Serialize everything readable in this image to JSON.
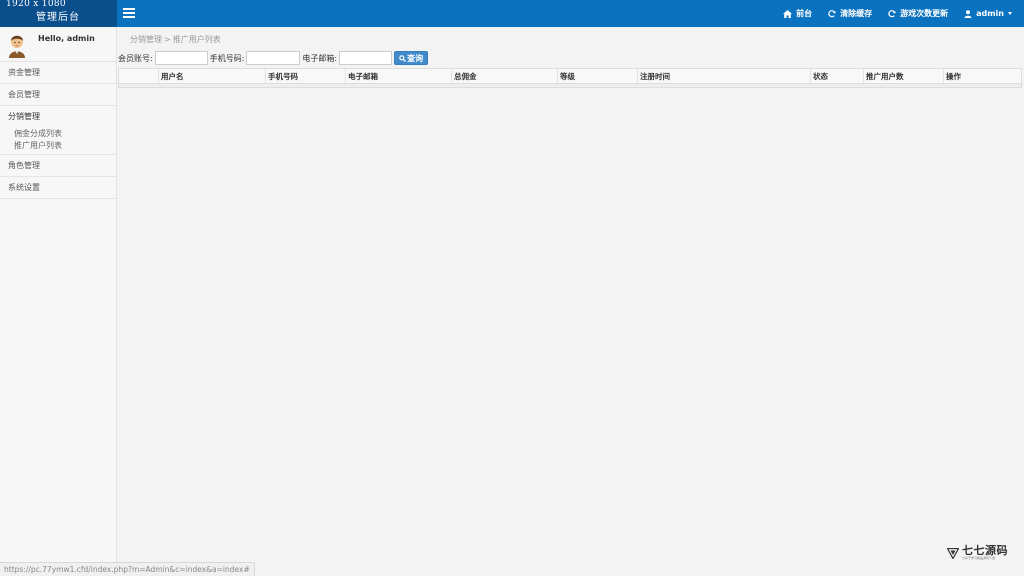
{
  "brand": {
    "resolution": "1920 x 1080",
    "name": "管理后台"
  },
  "topnav": {
    "home": "前台",
    "clear_cache": "清除缓存",
    "game_update": "游戏次数更新",
    "user": "admin"
  },
  "sidebar": {
    "greeting": "Hello, admin",
    "items": [
      {
        "label": "资金管理"
      },
      {
        "label": "会员管理"
      },
      {
        "label": "分销管理",
        "children": [
          "佣金分成列表",
          "推广用户列表"
        ]
      },
      {
        "label": "角色管理"
      },
      {
        "label": "系统设置"
      }
    ]
  },
  "breadcrumb": {
    "parent": "分销管理",
    "separator": ">",
    "current": "推广用户列表"
  },
  "filter": {
    "account_label": "会员账号:",
    "account_value": "",
    "phone_label": "手机号码:",
    "phone_value": "",
    "email_label": "电子邮箱:",
    "email_value": "",
    "search_button": "查询"
  },
  "table": {
    "columns": [
      "",
      "用户名",
      "手机号码",
      "电子邮箱",
      "总佣金",
      "等级",
      "注册时间",
      "状态",
      "推广用户数",
      "操作"
    ],
    "rows": []
  },
  "statusbar": {
    "url": "https://pc.77ymw1.cfd/index.php?m=Admin&c=index&a=index#"
  },
  "watermark": {
    "title": "七七源码",
    "subtitle": "分享于学习精品源码下载"
  },
  "colors": {
    "topbar": "#0b72bf",
    "brand_bg": "#0a4e8c",
    "search_button": "#428bca"
  }
}
